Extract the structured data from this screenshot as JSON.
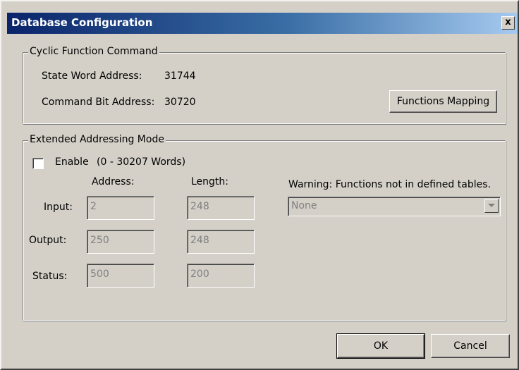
{
  "window": {
    "title": "Database Configuration",
    "close_label": "x"
  },
  "cyclic": {
    "legend": "Cyclic Function Command",
    "state_word_label": "State Word Address:",
    "state_word_value": "31744",
    "command_bit_label": "Command Bit Address:",
    "command_bit_value": "30720",
    "functions_mapping_button": "Functions Mapping"
  },
  "extended": {
    "legend": "Extended Addressing Mode",
    "enable_label": "Enable",
    "enable_range": "(0 - 30207 Words)",
    "enable_checked": false,
    "address_header": "Address:",
    "length_header": "Length:",
    "rows": [
      {
        "label": "Input:",
        "address": "2",
        "length": "248"
      },
      {
        "label": "Output:",
        "address": "250",
        "length": "248"
      },
      {
        "label": "Status:",
        "address": "500",
        "length": "200"
      }
    ],
    "warning_label": "Warning: Functions not in defined tables.",
    "warning_select_value": "None"
  },
  "buttons": {
    "ok": "OK",
    "cancel": "Cancel"
  },
  "colors": {
    "dialog_face": "#d4d0c8",
    "title_active_start": "#0a246a",
    "title_active_end": "#a6caf0",
    "disabled_text": "#808080"
  }
}
